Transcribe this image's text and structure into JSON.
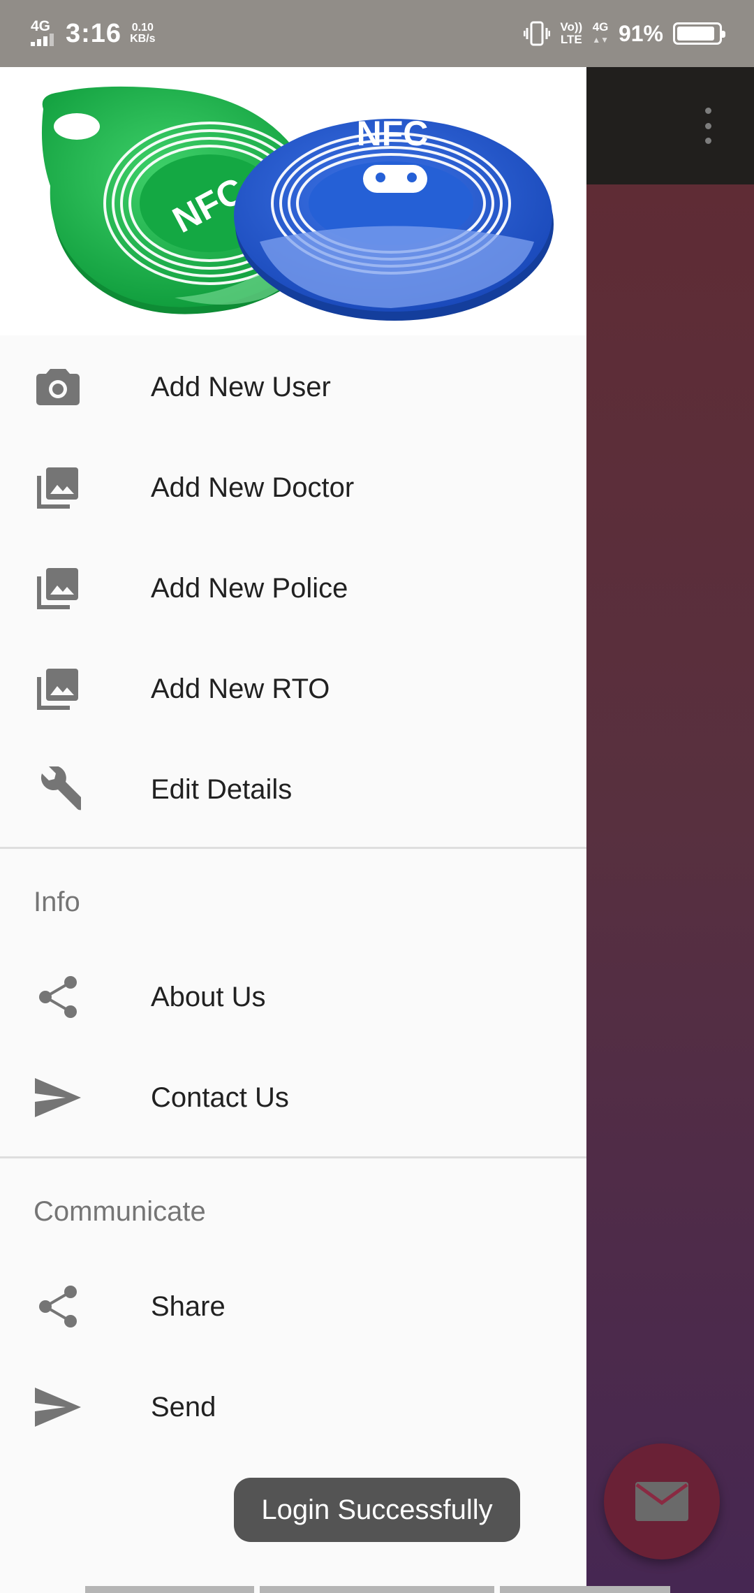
{
  "status_bar": {
    "network": "4G",
    "time": "3:16",
    "speed_value": "0.10",
    "speed_unit": "KB/s",
    "volte_top": "Vo))",
    "volte_bottom": "LTE",
    "network_right": "4G",
    "battery_percent": "91%",
    "battery_level": 0.91
  },
  "drawer": {
    "header_image_text": "NFC",
    "menu": [
      {
        "label": "Add New User",
        "icon": "camera-icon"
      },
      {
        "label": "Add New Doctor",
        "icon": "photo-library-icon"
      },
      {
        "label": "Add New Police",
        "icon": "photo-library-icon"
      },
      {
        "label": "Add New RTO",
        "icon": "photo-library-icon"
      },
      {
        "label": "Edit Details",
        "icon": "wrench-icon"
      }
    ],
    "info_section": {
      "title": "Info",
      "items": [
        {
          "label": "About Us",
          "icon": "share-icon"
        },
        {
          "label": "Contact Us",
          "icon": "send-icon"
        }
      ]
    },
    "communicate_section": {
      "title": "Communicate",
      "items": [
        {
          "label": "Share",
          "icon": "share-icon"
        },
        {
          "label": "Send",
          "icon": "send-icon"
        }
      ]
    }
  },
  "toast": {
    "message": "Login Successfully"
  },
  "colors": {
    "status_bar": "#918d88",
    "drawer_bg": "#fafafa",
    "app_bar": "#211f1d",
    "fab": "#6a2136",
    "icon_gray": "#757575"
  }
}
